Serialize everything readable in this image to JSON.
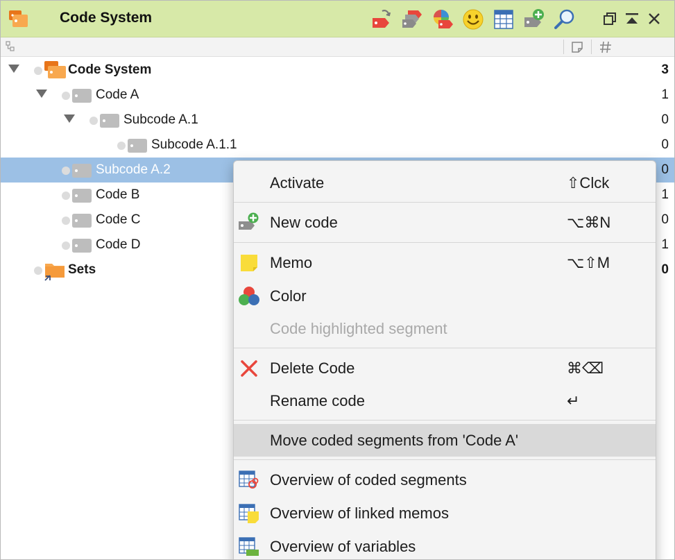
{
  "window": {
    "title": "Code System",
    "toolbar_icons": [
      "tag-arrow-icon",
      "tag-group-icon",
      "tag-color-icon",
      "smiley-icon",
      "table-icon",
      "new-tag-icon",
      "search-icon"
    ],
    "window_controls": [
      "detach-icon",
      "maximize-icon",
      "close-icon"
    ]
  },
  "header": {
    "columns": [
      "tree-icon",
      "memo-column-icon",
      "count-column-icon"
    ]
  },
  "tree": {
    "root": {
      "label": "Code System",
      "count": "3"
    },
    "code_a": {
      "label": "Code A",
      "count": "1"
    },
    "subcode_a1": {
      "label": "Subcode A.1",
      "count": "0"
    },
    "subcode_a11": {
      "label": "Subcode A.1.1",
      "count": "0"
    },
    "subcode_a2": {
      "label": "Subcode A.2",
      "count": "0"
    },
    "code_b": {
      "label": "Code B",
      "count": "1"
    },
    "code_c": {
      "label": "Code C",
      "count": "0"
    },
    "code_d": {
      "label": "Code D",
      "count": "1"
    },
    "sets": {
      "label": "Sets",
      "count": "0"
    }
  },
  "context_menu": {
    "items": [
      {
        "label": "Activate",
        "shortcut": "⇧Clck",
        "icon": ""
      },
      {
        "label": "New code",
        "shortcut": "⌥⌘N",
        "icon": "new-code-icon"
      },
      {
        "label": "Memo",
        "shortcut": "⌥⇧M",
        "icon": "memo-icon"
      },
      {
        "label": "Color",
        "shortcut": "",
        "icon": "color-icon"
      },
      {
        "label": "Code highlighted segment",
        "shortcut": "",
        "icon": "",
        "disabled": true
      },
      {
        "label": "Delete Code",
        "shortcut": "⌘⌫",
        "icon": "delete-icon"
      },
      {
        "label": "Rename code",
        "shortcut": "↵",
        "icon": ""
      },
      {
        "label": "Move coded segments from 'Code A'",
        "shortcut": "",
        "icon": "",
        "highlighted": true
      },
      {
        "label": "Overview of coded segments",
        "shortcut": "",
        "icon": "overview-segments-icon"
      },
      {
        "label": "Overview of linked memos",
        "shortcut": "",
        "icon": "overview-memos-icon"
      },
      {
        "label": "Overview of variables",
        "shortcut": "",
        "icon": "overview-variables-icon"
      }
    ]
  },
  "colors": {
    "titlebar": "#d7e9a8",
    "selection": "#9cc0e5",
    "menu_bg": "#f4f4f4",
    "menu_highlight": "#d9d9d9",
    "code_tag": "#b7b7b7",
    "orange": "#f59a3b"
  }
}
